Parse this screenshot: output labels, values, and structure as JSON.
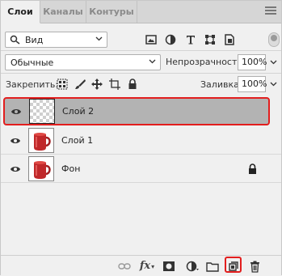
{
  "tabs": [
    {
      "label": "Слои",
      "active": true
    },
    {
      "label": "Каналы",
      "active": false
    },
    {
      "label": "Контуры",
      "active": false
    }
  ],
  "filter": {
    "selected": "Вид"
  },
  "blend": {
    "selected": "Обычные"
  },
  "opacity": {
    "label": "Непрозрачность:",
    "value": "100%"
  },
  "lock": {
    "label": "Закрепить:"
  },
  "fill": {
    "label": "Заливка:",
    "value": "100%"
  },
  "layers": [
    {
      "name": "Слой 2",
      "selected": true,
      "thumbnail": "transparent",
      "locked": false
    },
    {
      "name": "Слой 1",
      "selected": false,
      "thumbnail": "red-cup",
      "locked": false
    },
    {
      "name": "Фон",
      "selected": false,
      "thumbnail": "red-cup",
      "locked": true
    }
  ],
  "colors": {
    "highlight": "#e21e1e",
    "selected_row": "#b3b3b3",
    "cup": "#c0282a"
  }
}
